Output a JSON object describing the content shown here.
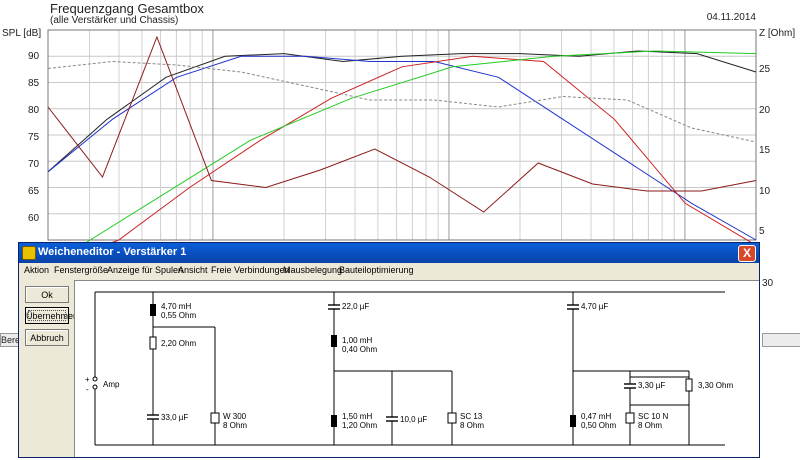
{
  "chart": {
    "title": "Frequenzgang Gesamtbox",
    "subtitle": "(alle Verstärker und Chassis)",
    "date": "04.11.2014",
    "ylabel_left": "SPL [dB]",
    "ylabel_right": "Z [Ohm]",
    "left_ticks": [
      "90",
      "85",
      "80",
      "75",
      "70",
      "65",
      "60"
    ],
    "right_ticks": [
      "25",
      "20",
      "15",
      "10",
      "5"
    ],
    "right_tick_bottom": "30"
  },
  "chart_data": {
    "type": "line",
    "ylim_spl": [
      55,
      95
    ],
    "ylim_z": [
      0,
      30
    ],
    "x_scale": "log",
    "grid": true,
    "series": [
      {
        "color": "#222222",
        "values": [
          68,
          78,
          86,
          90,
          90.5,
          89,
          90,
          90.5,
          90.5,
          90,
          91,
          90.5,
          87
        ]
      },
      {
        "color": "#2233cc",
        "values": [
          68,
          78,
          86,
          90,
          90,
          89,
          89,
          86,
          78,
          70,
          62,
          55
        ]
      },
      {
        "color": "#cc2222",
        "values": [
          50,
          55,
          65,
          74,
          82,
          88,
          90,
          89,
          78,
          62,
          54
        ]
      },
      {
        "color": "#22cc22",
        "values": [
          50,
          62,
          74,
          82,
          88,
          90,
          91,
          90.5
        ]
      },
      {
        "color": "#8b1a1a",
        "values": [
          19,
          9,
          29,
          8.5,
          7.5,
          10,
          13,
          9,
          4,
          11,
          8,
          7,
          7,
          8.5
        ]
      },
      {
        "color": "#888888",
        "values": [
          24.5,
          25.5,
          25,
          24,
          22,
          20,
          20,
          19,
          20.5,
          20,
          16,
          14
        ]
      }
    ]
  },
  "window": {
    "title": "Weicheneditor - Verstärker 1",
    "close": "X",
    "menu": [
      "Aktion",
      "Fenstergröße",
      "Anzeige für Spulen",
      "Ansicht",
      "Freie Verbindungen",
      "Mausbelegung",
      "Bauteiloptimierung"
    ],
    "buttons": {
      "ok": "Ok",
      "apply": "Übernehmen",
      "cancel": "Abbruch"
    }
  },
  "circuit": {
    "amp": "Amp",
    "plus": "+",
    "minus": "-",
    "c1_l1": "4,70 mH",
    "c1_l2": "0,55 Ohm",
    "c1_r1": "2,20 Ohm",
    "c1_c1": "33,0 µF",
    "c1_spk1": "W 300",
    "c1_spk2": "8 Ohm",
    "c2_c1": "22,0 µF",
    "c2_l1a": "1,00 mH",
    "c2_l1b": "0,40 Ohm",
    "c2_l2a": "1,50 mH",
    "c2_l2b": "1,20 Ohm",
    "c2_c2": "10,0 µF",
    "c2_spk1": "SC 13",
    "c2_spk2": "8 Ohm",
    "c3_c1": "4,70 µF",
    "c3_c2": "3,30 µF",
    "c3_r1": "3,30 Ohm",
    "c3_l1a": "0,47 mH",
    "c3_l1b": "0,50 Ohm",
    "c3_spk1": "SC 10 N",
    "c3_spk2": "8 Ohm"
  },
  "statusbar": {
    "left": "Bere"
  }
}
